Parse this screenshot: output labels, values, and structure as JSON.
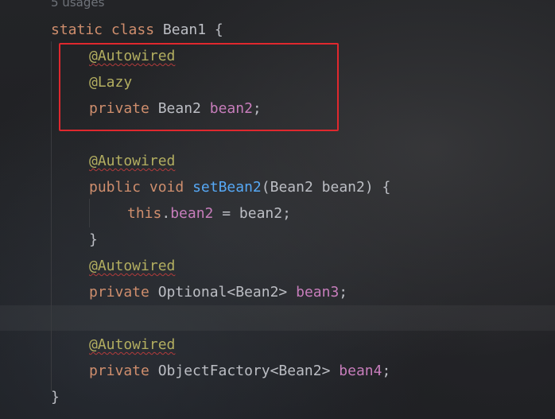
{
  "editor": {
    "usages_hint": "5 usages",
    "class_decl": {
      "kw1": "static",
      "kw2": "class",
      "name": "Bean1",
      "brace": " {"
    },
    "field1": {
      "annotation1": "@Autowired",
      "annotation2": "@Lazy",
      "modifier": "private",
      "type": "Bean2",
      "name": "bean2",
      "end": ";"
    },
    "method": {
      "annotation": "@Autowired",
      "modifier": "public",
      "return_type": "void",
      "name": "setBean2",
      "params": "(Bean2 bean2) {",
      "body_this": "this",
      "body_dot": ".",
      "body_field": "bean2",
      "body_rest": " = bean2;",
      "close": "}"
    },
    "field2": {
      "annotation": "@Autowired",
      "modifier": "private",
      "type": "Optional<Bean2>",
      "name": "bean3",
      "end": ";"
    },
    "field3": {
      "annotation": "@Autowired",
      "modifier": "private",
      "type": "ObjectFactory<Bean2>",
      "name": "bean4",
      "end": ";"
    },
    "class_close": "}"
  },
  "colors": {
    "keyword": "#cf8e6d",
    "annotation": "#b3ae60",
    "field": "#c77dbb",
    "method": "#56a8f5",
    "text": "#bcbec4",
    "highlight_box": "#e0282e"
  }
}
